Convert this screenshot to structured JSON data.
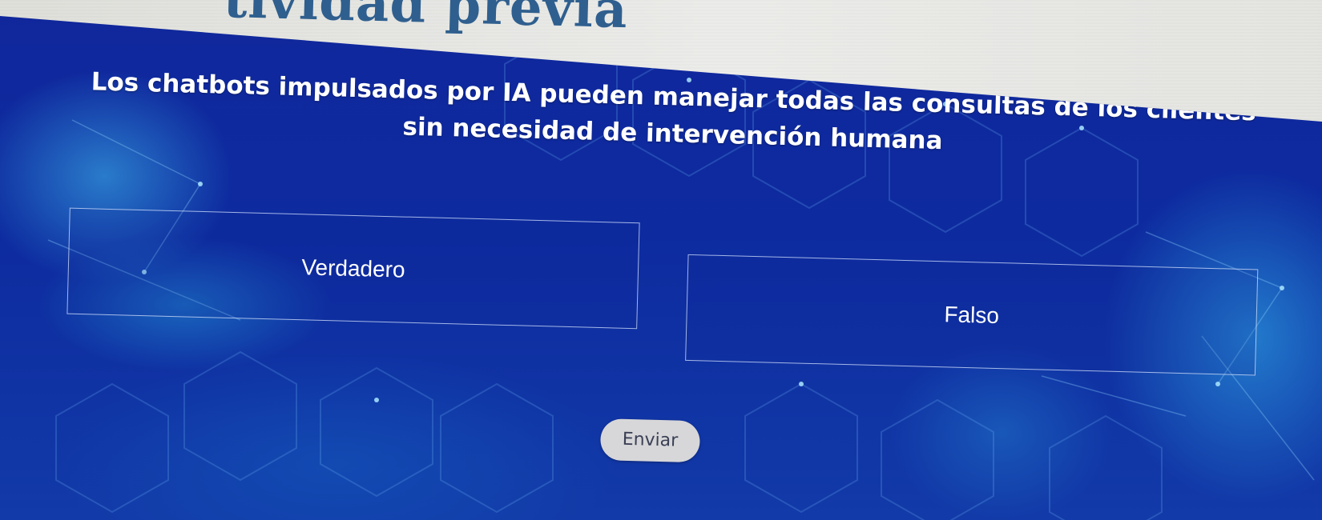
{
  "activity": {
    "heading": "tividad previa"
  },
  "quiz": {
    "question": "Los chatbots impulsados por IA pueden manejar todas las consultas de los clientes sin necesidad de intervención humana",
    "options": [
      {
        "label": "Verdadero"
      },
      {
        "label": "Falso"
      }
    ],
    "submit_label": "Enviar"
  },
  "theme": {
    "panel_color": "#10279c",
    "accent_glow": "#40bef0",
    "heading_color": "#2f5f8e",
    "button_bg": "#d7d7d9",
    "button_text": "#3a3f54"
  }
}
